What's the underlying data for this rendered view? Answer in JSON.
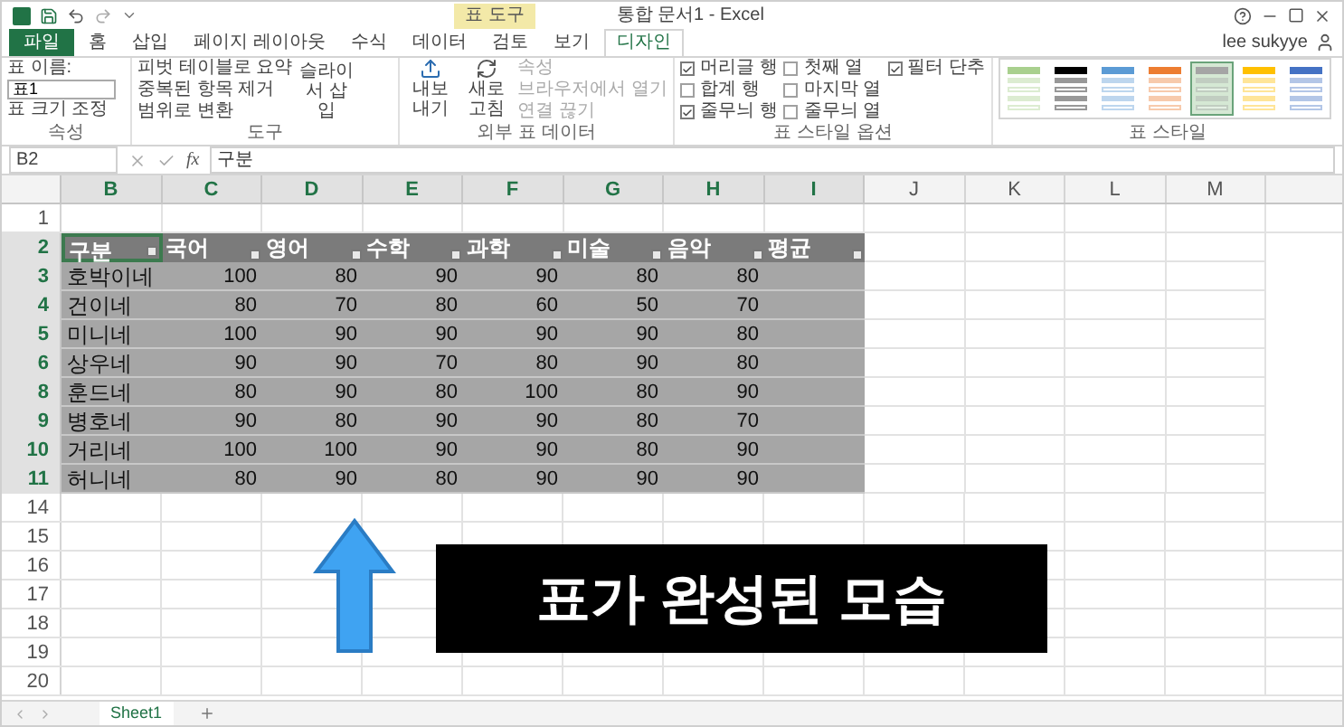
{
  "window": {
    "title": "통합 문서1 - Excel",
    "context_tab": "표 도구",
    "user": "lee sukyye"
  },
  "ribbon_tabs": [
    {
      "label": "파일",
      "kind": "file",
      "selected": false
    },
    {
      "label": "홈",
      "kind": "tab",
      "selected": false
    },
    {
      "label": "삽입",
      "kind": "tab",
      "selected": false
    },
    {
      "label": "페이지 레이아웃",
      "kind": "tab",
      "selected": false
    },
    {
      "label": "수식",
      "kind": "tab",
      "selected": false
    },
    {
      "label": "데이터",
      "kind": "tab",
      "selected": false
    },
    {
      "label": "검토",
      "kind": "tab",
      "selected": false
    },
    {
      "label": "보기",
      "kind": "tab",
      "selected": false
    },
    {
      "label": "디자인",
      "kind": "tab",
      "selected": true
    }
  ],
  "properties_group": {
    "label": "속성",
    "table_name_label": "표 이름:",
    "table_name": "표1",
    "resize": "표 크기 조정"
  },
  "tools_group": {
    "label": "도구",
    "items": [
      "피벗 테이블로 요약",
      "중복된 항목 제거",
      "범위로 변환"
    ],
    "slicer": "슬라이서 삽입"
  },
  "external_group": {
    "label": "외부 표 데이터",
    "buttons": [
      "내보내기",
      "새로 고침"
    ],
    "items": [
      {
        "label": "속성",
        "disabled": true
      },
      {
        "label": "브라우저에서 열기",
        "disabled": true
      },
      {
        "label": "연결 끊기",
        "disabled": true
      }
    ]
  },
  "style_options_group": {
    "label": "표 스타일 옵션",
    "options": [
      {
        "label": "머리글 행",
        "checked": true
      },
      {
        "label": "합계 행",
        "checked": false
      },
      {
        "label": "줄무늬 행",
        "checked": true
      },
      {
        "label": "첫째 열",
        "checked": false
      },
      {
        "label": "마지막 열",
        "checked": false
      },
      {
        "label": "줄무늬 열",
        "checked": false
      },
      {
        "label": "필터 단추",
        "checked": true
      }
    ]
  },
  "styles_group": {
    "label": "표 스타일",
    "styles": [
      {
        "color": "#a9d08e",
        "selected": false
      },
      {
        "color": "#000000",
        "selected": false
      },
      {
        "color": "#5b9bd5",
        "selected": false
      },
      {
        "color": "#ed7d31",
        "selected": false
      },
      {
        "color": "#a5a5a5",
        "selected": true
      },
      {
        "color": "#ffc000",
        "selected": false
      },
      {
        "color": "#4472c4",
        "selected": false
      }
    ]
  },
  "formula_bar": {
    "name_box": "B2",
    "function_label": "fx",
    "value": "구분"
  },
  "sheet": {
    "columns": [
      "B",
      "C",
      "D",
      "E",
      "F",
      "G",
      "H",
      "I",
      "J",
      "K",
      "L",
      "M"
    ],
    "empty_rows_before": [
      "1"
    ],
    "table": {
      "header_row": "2",
      "headers": [
        "구분",
        "국어",
        "영어",
        "수학",
        "과학",
        "미술",
        "음악",
        "평균"
      ],
      "rows": [
        {
          "row": "3",
          "cells": [
            "호박이네",
            "100",
            "80",
            "90",
            "90",
            "80",
            "80"
          ]
        },
        {
          "row": "4",
          "cells": [
            "건이네",
            "80",
            "70",
            "80",
            "60",
            "50",
            "70"
          ]
        },
        {
          "row": "5",
          "cells": [
            "미니네",
            "100",
            "90",
            "90",
            "90",
            "90",
            "80"
          ]
        },
        {
          "row": "6",
          "cells": [
            "상우네",
            "90",
            "90",
            "70",
            "80",
            "90",
            "80"
          ]
        },
        {
          "row": "8",
          "cells": [
            "훈드네",
            "80",
            "90",
            "80",
            "100",
            "80",
            "90"
          ]
        },
        {
          "row": "9",
          "cells": [
            "병호네",
            "90",
            "80",
            "90",
            "90",
            "80",
            "70"
          ]
        },
        {
          "row": "10",
          "cells": [
            "거리네",
            "100",
            "100",
            "90",
            "90",
            "80",
            "90"
          ]
        },
        {
          "row": "11",
          "cells": [
            "허니네",
            "80",
            "90",
            "80",
            "90",
            "90",
            "90"
          ]
        }
      ]
    },
    "empty_rows_after": [
      "14",
      "15",
      "16",
      "17",
      "18",
      "19",
      "20"
    ]
  },
  "sheet_tabs": [
    {
      "label": "Sheet1",
      "selected": true
    }
  ],
  "caption": "표가 완성된 모습"
}
